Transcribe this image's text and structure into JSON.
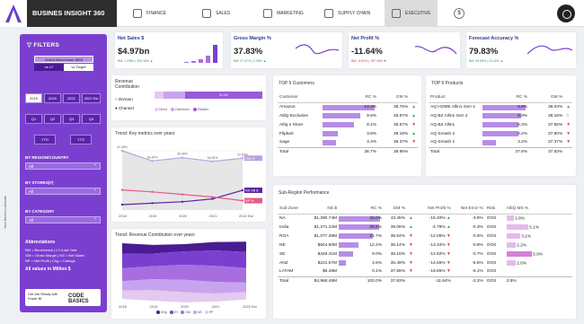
{
  "brand": "BUSINES INSIGHT 360",
  "nav": [
    {
      "label": "FINANCE",
      "icon": "finance-icon"
    },
    {
      "label": "SALES",
      "icon": "sales-icon"
    },
    {
      "label": "MARKETING",
      "icon": "marketing-icon"
    },
    {
      "label": "SUPPLY CHAIN",
      "icon": "supply-chain-icon"
    },
    {
      "label": "EXECUTIVE",
      "icon": "executive-icon"
    }
  ],
  "sidebar": {
    "title": "FILTERS",
    "benchmark_label": "Select Benchmark (BM)",
    "bm_options": [
      "vs LY",
      "vs Target"
    ],
    "years": [
      "2019",
      "2020",
      "2021",
      "2022 Est"
    ],
    "quarters": [
      "Q1",
      "Q2",
      "Q3",
      "Q4"
    ],
    "ytd": [
      "YTD",
      "YTG"
    ],
    "region_label": "BY REGION/COUNTRY",
    "region_value": "All",
    "stores_label": "BY STORES(#)",
    "stores_value": "All",
    "category_label": "BY CATEGORY",
    "category_value": "All",
    "abbr_title": "Abbreviations",
    "abbr_lines": [
      "BM = Benchmark | LY=Last Year",
      "GM = Gross Margin | NS = Net Sales",
      "NP = Net Profit | Chg = Change"
    ],
    "units_note": "All values in Million $",
    "cb_text": "Get Job Ready with Power BI",
    "cb_brand": "CODE BASICS",
    "credit": "Yash Devesh Lokhande"
  },
  "kpis": [
    {
      "title": "Net Sales $",
      "value": "$4.97bn",
      "sub": "BM: 1.23Bn | 303.18% ▲",
      "sub_color": "#3aa047"
    },
    {
      "title": "Gross Margin %",
      "value": "37.83%",
      "sub": "BM: 37.07% | 2.05% ▲",
      "sub_color": "#3aa047"
    },
    {
      "title": "Net Profit %",
      "value": "-11.64%",
      "sub": "BM: -6.52% | 157.16% ▼",
      "sub_color": "#d23b3b"
    },
    {
      "title": "Forecast Accuracy %",
      "value": "79.83%",
      "sub": "BM: 63.65% | 25.42% ▲",
      "sub_color": "#3aa047"
    }
  ],
  "revenue_contribution": {
    "title": "Revenue Contribution",
    "options": [
      "Division",
      "Channel"
    ],
    "bar_labels": [
      "",
      "",
      "11.1%"
    ],
    "legend": [
      "Direct",
      "Distributor",
      "Retailer"
    ]
  },
  "trend_metrics": {
    "title": "Trend: Key metrics over years",
    "tags": [
      "GM %",
      "NS Mil $",
      "NP %"
    ],
    "labels_top": [
      "41.45%",
      "36.49%",
      "38.08%",
      "36.25%",
      "37.83%"
    ]
  },
  "trend_revenue": {
    "title": "Trend: Revenue Contribution over years",
    "legend": [
      "BSg",
      "EY",
      "GM",
      "NS",
      "PP"
    ]
  },
  "chart_data": [
    {
      "type": "line",
      "title": "Trend: Key metrics over years",
      "x": [
        "2018",
        "2019",
        "2020",
        "2021",
        "2022 Est"
      ],
      "series": [
        {
          "name": "GM %",
          "values": [
            41.45,
            36.49,
            38.08,
            36.25,
            37.83
          ]
        },
        {
          "name": "NS Mil $",
          "values": [
            10,
            12,
            14,
            18,
            30
          ]
        },
        {
          "name": "NP %",
          "values": [
            5,
            2,
            -2,
            -6,
            -11.64
          ]
        }
      ]
    },
    {
      "type": "area",
      "title": "Trend: Revenue Contribution over years",
      "x": [
        "2018",
        "2019",
        "2020",
        "2021",
        "2022 Est"
      ],
      "legend": [
        "BSg",
        "EY",
        "GM",
        "NS",
        "PP"
      ]
    }
  ],
  "top_customers": {
    "title": "TOP 5 Customers",
    "headers": [
      "Customer",
      "RC %",
      "GM %"
    ],
    "rows": [
      {
        "name": "Amazon",
        "rc": "13.3%",
        "rc_frac": 1.0,
        "gm": "38.76%",
        "trend": "up"
      },
      {
        "name": "AtliQ Exclusive",
        "rc": "9.6%",
        "rc_frac": 0.72,
        "gm": "45.67%",
        "trend": "up"
      },
      {
        "name": "Atliq e Store",
        "rc": "8.1%",
        "rc_frac": 0.61,
        "gm": "35.57%",
        "trend": "dn"
      },
      {
        "name": "Flipkart",
        "rc": "3.8%",
        "rc_frac": 0.29,
        "gm": "38.18%",
        "trend": "up"
      },
      {
        "name": "Sage",
        "rc": "3.4%",
        "rc_frac": 0.26,
        "gm": "36.37%",
        "trend": "dn"
      }
    ],
    "total": {
      "name": "Total",
      "rc": "38.7%",
      "gm": "38.96%"
    }
  },
  "top_products": {
    "title": "TOP 5 Products",
    "headers": [
      "Product",
      "RC %",
      "GM %"
    ],
    "rows": [
      {
        "name": "AQ HOME Allin1 Gen 2",
        "rc": "9.9%",
        "rc_frac": 1.0,
        "gm": "38.04%",
        "trend": "up"
      },
      {
        "name": "AQ BZ Allin1 Gen 2",
        "rc": "8.8%",
        "rc_frac": 0.89,
        "gm": "38.16%",
        "trend": "neutral"
      },
      {
        "name": "AQ BZ Allin1",
        "rc": "8.3%",
        "rc_frac": 0.84,
        "gm": "37.55%",
        "trend": "dn"
      },
      {
        "name": "AQ Smash 2",
        "rc": "8.2%",
        "rc_frac": 0.83,
        "gm": "37.90%",
        "trend": "dn"
      },
      {
        "name": "AQ Smash 1",
        "rc": "3.2%",
        "rc_frac": 0.32,
        "gm": "37.37%",
        "trend": "dn"
      }
    ],
    "total": {
      "name": "Total",
      "rc": "37.8%",
      "gm": "37.83%"
    }
  },
  "sub_region": {
    "title": "Sub-Region Performance",
    "headers": [
      "Sub Zone",
      "NS $",
      "RC %",
      "GM %",
      "",
      "Net Profit %",
      "Net Error %",
      "Risk",
      "AtliQ MS %"
    ],
    "rows": [
      {
        "zone": "NA",
        "ns": "$1,290.74M",
        "ns_frac": 1.0,
        "rc": "26.0%",
        "gm": "43.45%",
        "gm_t": "up",
        "np": "-15.40%",
        "np_t": "up",
        "ne": "-3.6%",
        "risk": "OOS",
        "ms": "1.8%",
        "ms_frac": 0.3
      },
      {
        "zone": "India",
        "ns": "$1,271.22M",
        "ns_frac": 0.98,
        "rc": "25.6%",
        "gm": "38.06%",
        "gm_t": "up",
        "np": "-4.78%",
        "np_t": "up",
        "ne": "-0.3%",
        "risk": "OOS",
        "ms": "5.1%",
        "ms_frac": 0.85
      },
      {
        "zone": "ROA",
        "ns": "$1,077.38M",
        "ns_frac": 0.83,
        "rc": "21.7%",
        "gm": "35.54%",
        "gm_t": "dn",
        "np": "-12.05%",
        "np_t": "dn",
        "ne": "-0.6%",
        "risk": "OOS",
        "ms": "3.1%",
        "ms_frac": 0.52
      },
      {
        "zone": "NE",
        "ns": "$604.60M",
        "ns_frac": 0.47,
        "rc": "12.2%",
        "gm": "35.14%",
        "gm_t": "dn",
        "np": "-13.34%",
        "np_t": "dn",
        "ne": "-0.8%",
        "risk": "OOS",
        "ms": "2.2%",
        "ms_frac": 0.37
      },
      {
        "zone": "SE",
        "ns": "$449.41M",
        "ns_frac": 0.35,
        "rc": "9.0%",
        "gm": "35.18%",
        "gm_t": "dn",
        "np": "-12.82%",
        "np_t": "dn",
        "ne": "-0.7%",
        "risk": "OOS",
        "ms": "5.9%",
        "ms_frac": 1.0
      },
      {
        "zone": "ANZ",
        "ns": "$221.67M",
        "ns_frac": 0.17,
        "rc": "4.5%",
        "gm": "35.49%",
        "gm_t": "dn",
        "np": "-14.55%",
        "np_t": "dn",
        "ne": "-5.5%",
        "risk": "OOS",
        "ms": "2.0%",
        "ms_frac": 0.34
      },
      {
        "zone": "LATAM",
        "ns": "$5.48M",
        "ns_frac": 0.01,
        "rc": "0.1%",
        "gm": "37.86%",
        "gm_t": "dn",
        "np": "-19.65%",
        "np_t": "dn",
        "ne": "-6.1%",
        "risk": "OOS",
        "ms": "",
        "ms_frac": 0
      }
    ],
    "total": {
      "zone": "Total",
      "ns": "$4,968.48M",
      "rc": "100.0%",
      "gm": "37.83%",
      "np": "-11.64%",
      "ne": "-2.2%",
      "risk": "OOS",
      "ms": "2.5%"
    }
  }
}
